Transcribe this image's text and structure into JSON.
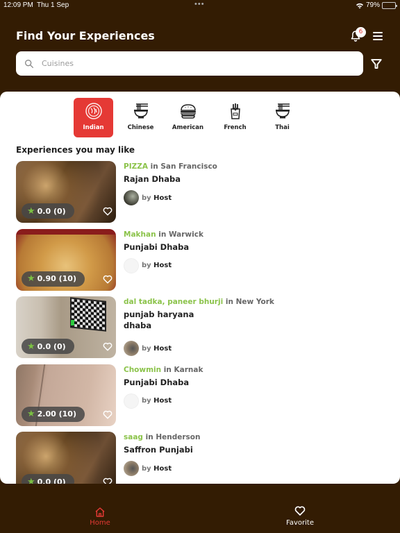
{
  "status_bar": {
    "time": "12:09 PM",
    "date": "Thu 1 Sep",
    "dots": "•••",
    "battery_percent": "79%",
    "battery_level": 0.79
  },
  "header": {
    "title": "Find Your Experiences",
    "notification_count": "6"
  },
  "search": {
    "placeholder": "Cuisines",
    "value": ""
  },
  "cuisines": [
    {
      "label": "Indian",
      "icon": "indian-plate-icon",
      "active": true
    },
    {
      "label": "Chinese",
      "icon": "noodle-bowl-icon",
      "active": false
    },
    {
      "label": "American",
      "icon": "burger-icon",
      "active": false
    },
    {
      "label": "French",
      "icon": "fries-icon",
      "active": false
    },
    {
      "label": "Thai",
      "icon": "noodle-bowl-icon",
      "active": false
    }
  ],
  "section_title": "Experiences you may like",
  "experiences": [
    {
      "dish": "PIZZA",
      "in": "in",
      "city": "San Francisco",
      "name": "Rajan Dhaba",
      "rating": "0.0 (0)",
      "by": "by",
      "host": "Host",
      "image": "dining-couple",
      "avatar": "photo"
    },
    {
      "dish": "Makhan",
      "in": "in",
      "city": "Warwick",
      "name": "Punjabi Dhaba",
      "rating": "0.90 (10)",
      "by": "by",
      "host": "Host",
      "image": "pizza",
      "avatar": "blank"
    },
    {
      "dish": "dal tadka, paneer bhurji",
      "in": "in",
      "city": "New York",
      "name": "punjab haryana dhaba",
      "rating": "0.0 (0)",
      "by": "by",
      "host": "Host",
      "image": "tv-room",
      "avatar": "photo"
    },
    {
      "dish": "Chowmin",
      "in": "in",
      "city": "Karnak",
      "name": "Punjabi Dhaba",
      "rating": "2.00 (10)",
      "by": "by",
      "host": "Host",
      "image": "ceiling",
      "avatar": "blank"
    },
    {
      "dish": "saag",
      "in": "in",
      "city": "Henderson",
      "name": "Saffron Punjabi",
      "rating": "0.0 (0)",
      "by": "by",
      "host": "Host",
      "image": "dining-couple",
      "avatar": "photo"
    }
  ],
  "bottom_nav": [
    {
      "label": "Home",
      "icon": "home-icon",
      "active": true
    },
    {
      "label": "Favorite",
      "icon": "heart-icon",
      "active": false
    }
  ],
  "colors": {
    "background": "#331c03",
    "accent": "#e53935",
    "dish_green": "#8bc34a",
    "star_green": "#7bc043"
  }
}
